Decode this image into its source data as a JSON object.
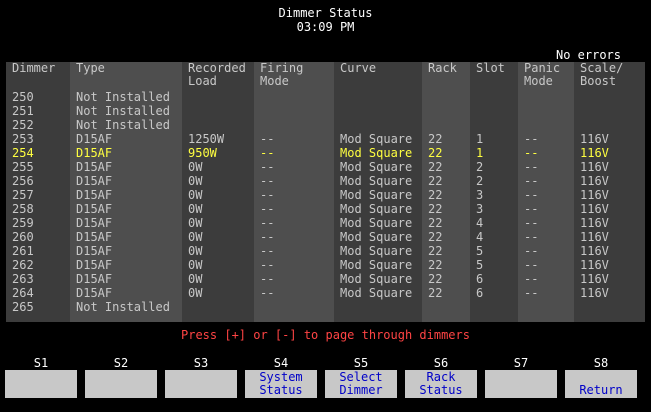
{
  "header": {
    "title": "Dimmer Status",
    "time": "03:09 PM"
  },
  "status": "No errors",
  "columns": [
    [
      "Dimmer",
      ""
    ],
    [
      "Type",
      ""
    ],
    [
      "Recorded",
      "Load"
    ],
    [
      "Firing",
      "Mode"
    ],
    [
      "Curve",
      ""
    ],
    [
      "Rack",
      ""
    ],
    [
      "Slot",
      ""
    ],
    [
      "Panic",
      "Mode"
    ],
    [
      "Scale/",
      "Boost"
    ]
  ],
  "rows": [
    [
      "250",
      "Not Installed",
      "",
      "",
      "",
      "",
      "",
      "",
      ""
    ],
    [
      "251",
      "Not Installed",
      "",
      "",
      "",
      "",
      "",
      "",
      ""
    ],
    [
      "252",
      "Not Installed",
      "",
      "",
      "",
      "",
      "",
      "",
      ""
    ],
    [
      "253",
      "D15AF",
      "1250W",
      "--",
      "Mod Square",
      "22",
      "1",
      "--",
      "116V"
    ],
    [
      "254",
      "D15AF",
      "950W",
      "--",
      "Mod Square",
      "22",
      "1",
      "--",
      "116V"
    ],
    [
      "255",
      "D15AF",
      "0W",
      "--",
      "Mod Square",
      "22",
      "2",
      "--",
      "116V"
    ],
    [
      "256",
      "D15AF",
      "0W",
      "--",
      "Mod Square",
      "22",
      "2",
      "--",
      "116V"
    ],
    [
      "257",
      "D15AF",
      "0W",
      "--",
      "Mod Square",
      "22",
      "3",
      "--",
      "116V"
    ],
    [
      "258",
      "D15AF",
      "0W",
      "--",
      "Mod Square",
      "22",
      "3",
      "--",
      "116V"
    ],
    [
      "259",
      "D15AF",
      "0W",
      "--",
      "Mod Square",
      "22",
      "4",
      "--",
      "116V"
    ],
    [
      "260",
      "D15AF",
      "0W",
      "--",
      "Mod Square",
      "22",
      "4",
      "--",
      "116V"
    ],
    [
      "261",
      "D15AF",
      "0W",
      "--",
      "Mod Square",
      "22",
      "5",
      "--",
      "116V"
    ],
    [
      "262",
      "D15AF",
      "0W",
      "--",
      "Mod Square",
      "22",
      "5",
      "--",
      "116V"
    ],
    [
      "263",
      "D15AF",
      "0W",
      "--",
      "Mod Square",
      "22",
      "6",
      "--",
      "116V"
    ],
    [
      "264",
      "D15AF",
      "0W",
      "--",
      "Mod Square",
      "22",
      "6",
      "--",
      "116V"
    ],
    [
      "265",
      "Not Installed",
      "",
      "",
      "",
      "",
      "",
      "",
      ""
    ]
  ],
  "selected_dimmer": "254",
  "hint": "Press [+] or [-] to page through dimmers",
  "softkeys": [
    {
      "id": "S1",
      "line1": "",
      "line2": ""
    },
    {
      "id": "S2",
      "line1": "",
      "line2": ""
    },
    {
      "id": "S3",
      "line1": "",
      "line2": ""
    },
    {
      "id": "S4",
      "line1": "System",
      "line2": "Status"
    },
    {
      "id": "S5",
      "line1": "Select",
      "line2": "Dimmer"
    },
    {
      "id": "S6",
      "line1": "Rack",
      "line2": "Status"
    },
    {
      "id": "S7",
      "line1": "",
      "line2": ""
    },
    {
      "id": "S8",
      "line1": "",
      "line2": "Return"
    }
  ],
  "colors": {
    "selected_row": "#ffff40",
    "hint": "#ff4444",
    "key_face": "#c8c8c8",
    "key_text": "#0000c8"
  }
}
